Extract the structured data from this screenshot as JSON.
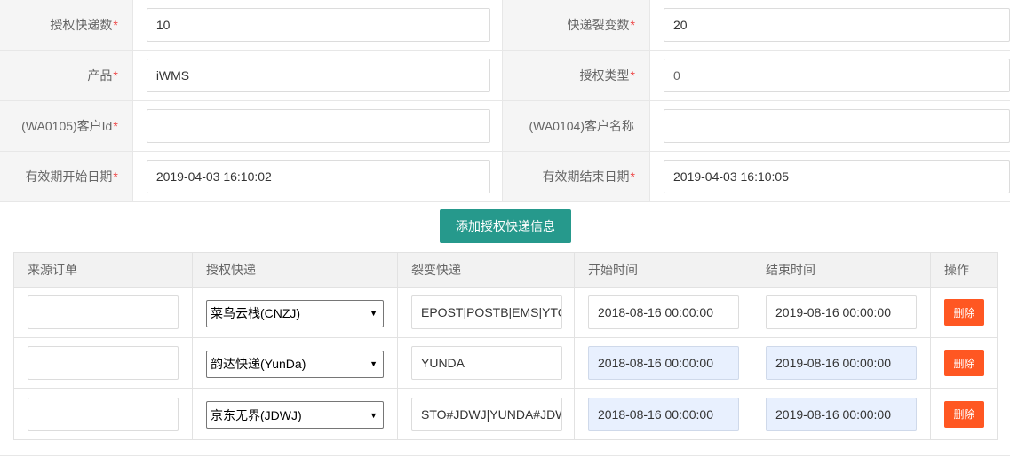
{
  "form": {
    "rows": [
      {
        "left": {
          "label": "授权快递数",
          "required": "*",
          "value": "10"
        },
        "right": {
          "label": "快递裂变数",
          "required": "*",
          "value": "20"
        }
      },
      {
        "left": {
          "label": "产品",
          "required": "*",
          "value": "iWMS"
        },
        "right": {
          "label": "授权类型",
          "required": "*",
          "value": "0"
        }
      },
      {
        "left": {
          "label": "(WA0105)客户Id",
          "required": "*",
          "value": ""
        },
        "right": {
          "label": "(WA0104)客户名称",
          "required": "",
          "value": ""
        }
      },
      {
        "left": {
          "label": "有效期开始日期",
          "required": "*",
          "value": "2019-04-03 16:10:02"
        },
        "right": {
          "label": "有效期结束日期",
          "required": "*",
          "value": "2019-04-03 16:10:05"
        }
      }
    ]
  },
  "add_button_label": "添加授权快递信息",
  "table": {
    "headers": [
      "来源订单",
      "授权快递",
      "裂变快递",
      "开始时间",
      "结束时间",
      "操作"
    ],
    "rows": [
      {
        "source": "",
        "express": "菜鸟云栈(CNZJ)",
        "split": "EPOST|POSTB|EMS|YTO",
        "start": "2018-08-16 00:00:00",
        "end": "2019-08-16 00:00:00",
        "action": "删除"
      },
      {
        "source": "",
        "express": "韵达快递(YunDa)",
        "split": "YUNDA",
        "start": "2018-08-16 00:00:00",
        "end": "2019-08-16 00:00:00",
        "action": "删除"
      },
      {
        "source": "",
        "express": "京东无界(JDWJ)",
        "split": "STO#JDWJ|YUNDA#JDWJ",
        "start": "2018-08-16 00:00:00",
        "end": "2019-08-16 00:00:00",
        "action": "删除"
      }
    ]
  },
  "colors": {
    "primary": "#26998c",
    "danger": "#ff5722",
    "required": "#e44444",
    "highlight": "#e8f0fe"
  }
}
